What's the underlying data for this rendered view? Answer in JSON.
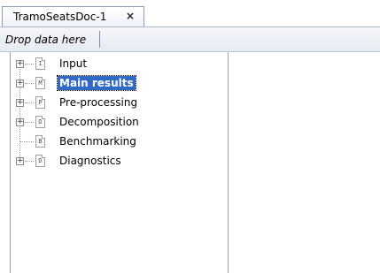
{
  "document_tab": {
    "title": "TramoSeatsDoc-1",
    "close_glyph": "×"
  },
  "dropzone": {
    "label": "Drop data here"
  },
  "tree": {
    "nodes": [
      {
        "label": "Input",
        "icon_letter": "I",
        "expandable": true,
        "selected": false
      },
      {
        "label": "Main results",
        "icon_letter": "M",
        "expandable": true,
        "selected": true
      },
      {
        "label": "Pre-processing",
        "icon_letter": "P",
        "expandable": true,
        "selected": false
      },
      {
        "label": "Decomposition",
        "icon_letter": "D",
        "expandable": true,
        "selected": false
      },
      {
        "label": "Benchmarking",
        "icon_letter": "B",
        "expandable": false,
        "selected": false
      },
      {
        "label": "Diagnostics",
        "icon_letter": "D",
        "expandable": true,
        "selected": false
      }
    ]
  },
  "colors": {
    "selection": "#3169c6",
    "border": "#a0a0a0"
  }
}
